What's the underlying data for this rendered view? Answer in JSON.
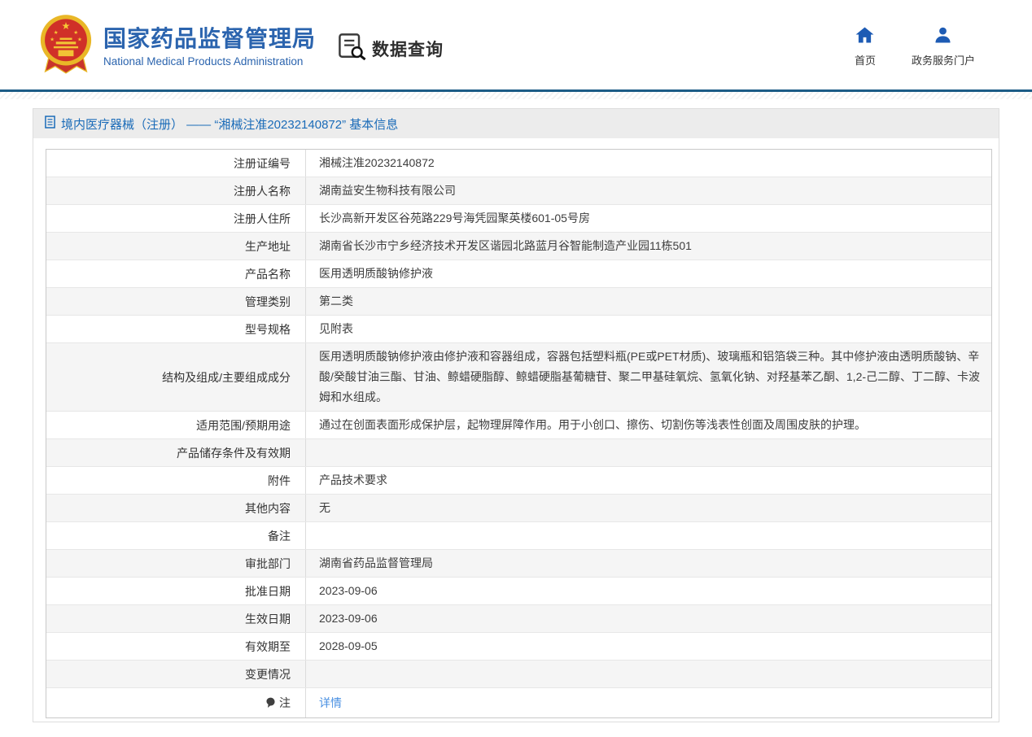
{
  "header": {
    "logo_title": "国家药品监督管理局",
    "logo_subtitle": "National Medical Products Administration",
    "query_label": "数据查询",
    "nav": [
      {
        "label": "首页",
        "icon": "home-icon"
      },
      {
        "label": "政务服务门户",
        "icon": "user-icon"
      }
    ]
  },
  "breadcrumb": {
    "text": "境内医疗器械（注册） —— “湘械注准20232140872” 基本信息"
  },
  "table": {
    "rows": [
      {
        "label": "注册证编号",
        "value": "湘械注准20232140872"
      },
      {
        "label": "注册人名称",
        "value": "湖南益安生物科技有限公司"
      },
      {
        "label": "注册人住所",
        "value": "长沙高新开发区谷苑路229号海凭园聚英楼601-05号房"
      },
      {
        "label": "生产地址",
        "value": "湖南省长沙市宁乡经济技术开发区谐园北路蓝月谷智能制造产业园11栋501"
      },
      {
        "label": "产品名称",
        "value": "医用透明质酸钠修护液"
      },
      {
        "label": "管理类别",
        "value": "第二类"
      },
      {
        "label": "型号规格",
        "value": "见附表"
      },
      {
        "label": "结构及组成/主要组成成分",
        "value": "医用透明质酸钠修护液由修护液和容器组成，容器包括塑料瓶(PE或PET材质)、玻璃瓶和铝箔袋三种。其中修护液由透明质酸钠、辛酸/癸酸甘油三酯、甘油、鲸蜡硬脂醇、鲸蜡硬脂基葡糖苷、聚二甲基硅氧烷、氢氧化钠、对羟基苯乙酮、1,2-己二醇、丁二醇、卡波姆和水组成。"
      },
      {
        "label": "适用范围/预期用途",
        "value": "通过在创面表面形成保护层，起物理屏障作用。用于小创口、擦伤、切割伤等浅表性创面及周围皮肤的护理。"
      },
      {
        "label": "产品储存条件及有效期",
        "value": ""
      },
      {
        "label": "附件",
        "value": "产品技术要求"
      },
      {
        "label": "其他内容",
        "value": "无"
      },
      {
        "label": "备注",
        "value": ""
      },
      {
        "label": "审批部门",
        "value": "湖南省药品监督管理局"
      },
      {
        "label": "批准日期",
        "value": "2023-09-06"
      },
      {
        "label": "生效日期",
        "value": "2023-09-06"
      },
      {
        "label": "有效期至",
        "value": "2028-09-05"
      },
      {
        "label": "变更情况",
        "value": ""
      },
      {
        "label": "注",
        "value": "详情",
        "link": true,
        "label_icon": "note-balloon-icon"
      }
    ]
  },
  "colors": {
    "brand_blue": "#2b64ae",
    "nav_icon_blue": "#1d5bb4",
    "header_rule_blue": "#1c5c86",
    "breadcrumb_text_blue": "#1a6bb8",
    "link_blue": "#4a90e2",
    "zebra_gray": "#f5f5f5",
    "breadcrumb_bg": "#ececec"
  }
}
